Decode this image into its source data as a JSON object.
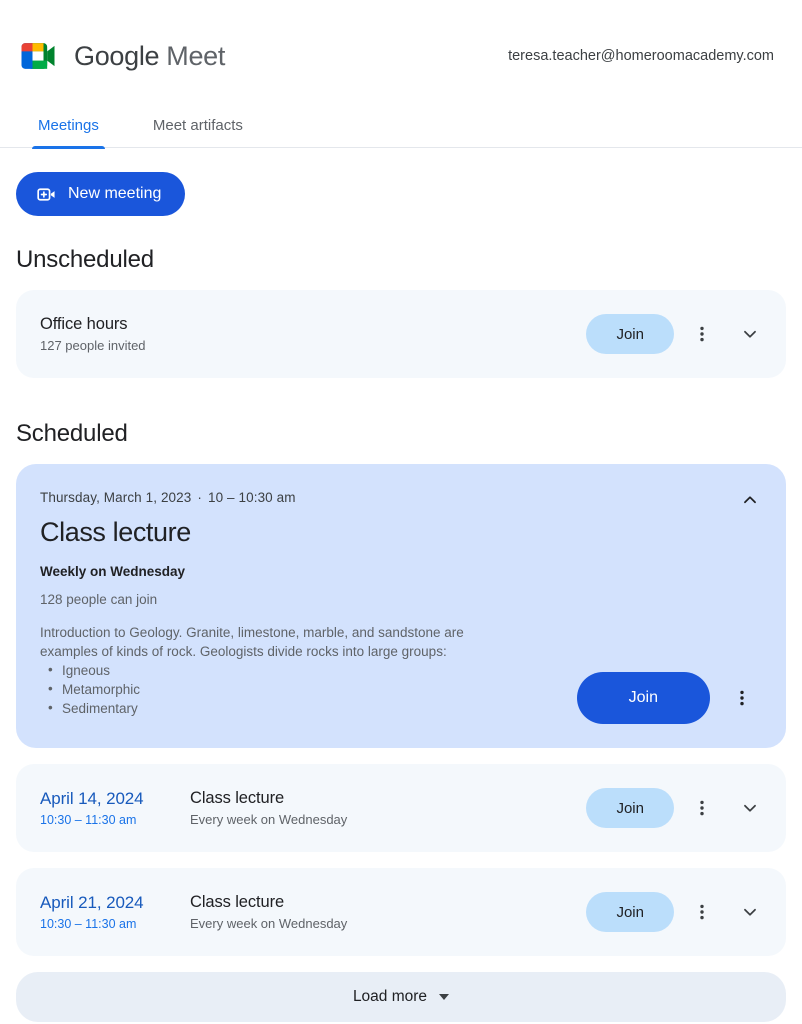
{
  "header": {
    "logo_icon": "google-meet-logo-icon",
    "brand_google": "Google",
    "brand_meet": "Meet",
    "account_email": "teresa.teacher@homeroomacademy.com"
  },
  "tabs": [
    {
      "label": "Meetings",
      "active": true
    },
    {
      "label": "Meet artifacts",
      "active": false
    }
  ],
  "toolbar": {
    "new_meeting_label": "New meeting",
    "new_meeting_icon": "new-video-call-icon"
  },
  "sections": {
    "unscheduled": {
      "title": "Unscheduled",
      "meetings": [
        {
          "title": "Office hours",
          "subtitle": "127 people invited",
          "join_label": "Join",
          "more_icon": "more-vertical-icon",
          "expand_icon": "chevron-down-icon"
        }
      ]
    },
    "scheduled": {
      "title": "Scheduled",
      "expanded_meeting": {
        "when": "Thursday, March 1, 2023",
        "separator": "·",
        "time": "10 – 10:30 am",
        "title": "Class lecture",
        "recurrence": "Weekly on Wednesday",
        "capacity": "128 people can join",
        "description": "Introduction to Geology. Granite, limestone, marble, and sandstone are examples of kinds of rock. Geologists divide rocks into large groups:",
        "bullets": [
          "Igneous",
          "Metamorphic",
          "Sedimentary"
        ],
        "join_label": "Join",
        "more_icon": "more-vertical-icon",
        "collapse_icon": "chevron-up-icon"
      },
      "meetings": [
        {
          "date": "April 14, 2024",
          "time": "10:30 – 11:30 am",
          "title": "Class lecture",
          "subtitle": "Every week on Wednesday",
          "join_label": "Join",
          "more_icon": "more-vertical-icon",
          "expand_icon": "chevron-down-icon"
        },
        {
          "date": "April 21, 2024",
          "time": "10:30 – 11:30 am",
          "title": "Class lecture",
          "subtitle": "Every week on Wednesday",
          "join_label": "Join",
          "more_icon": "more-vertical-icon",
          "expand_icon": "chevron-down-icon"
        }
      ]
    }
  },
  "footer": {
    "load_more_label": "Load more",
    "load_more_icon": "caret-down-icon"
  },
  "colors": {
    "accent_blue": "#1a73e8",
    "button_blue": "#1a56db",
    "join_light": "#bbdefb",
    "expanded_card": "#d3e2fd",
    "row_bg": "#f4f8fc",
    "load_more_bg": "#e8eef6",
    "text_primary": "#202124",
    "text_secondary": "#5f6368"
  }
}
